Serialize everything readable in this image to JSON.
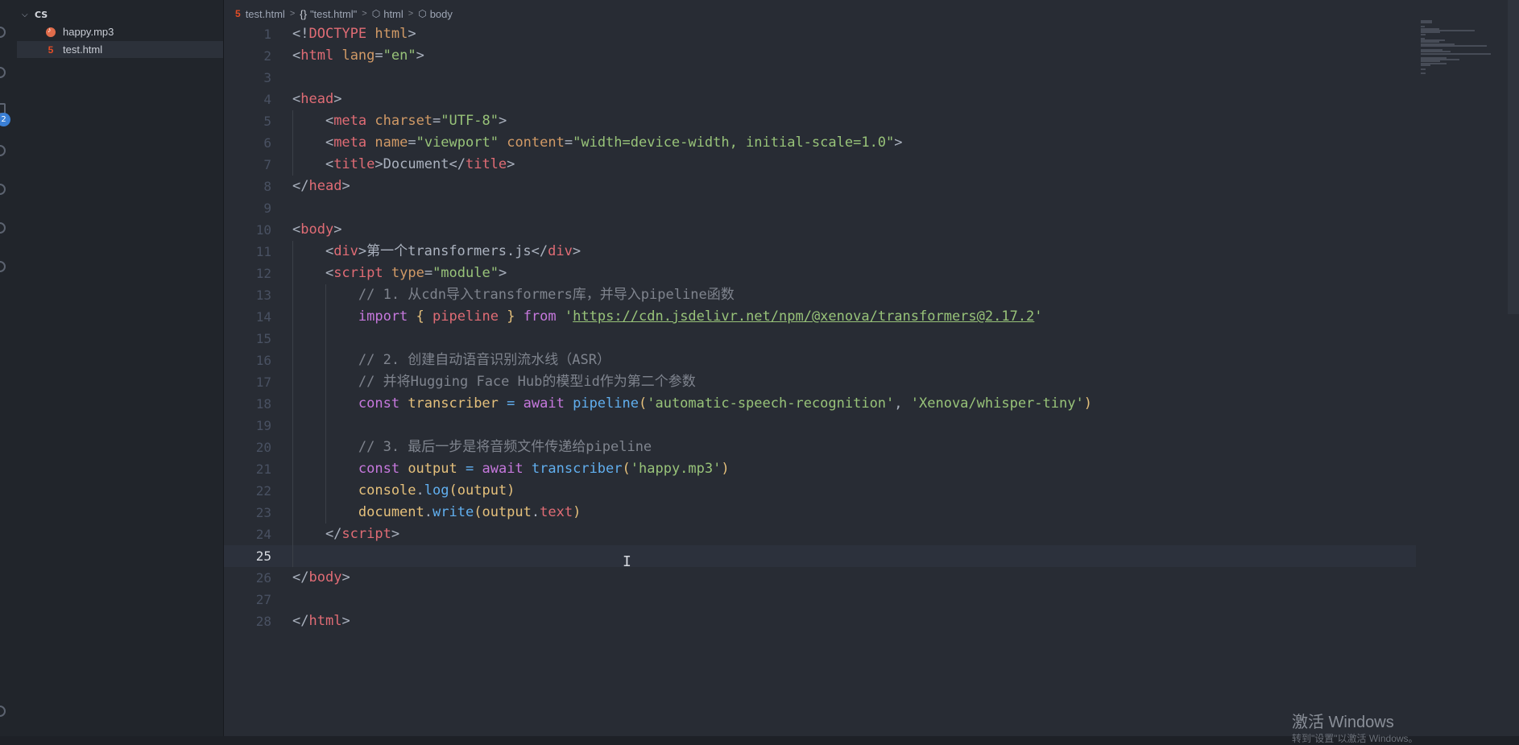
{
  "explorer": {
    "folder": "CS",
    "files": [
      {
        "name": "happy.mp3",
        "icon": "audio-file-icon",
        "active": false
      },
      {
        "name": "test.html",
        "icon": "html-file-icon",
        "active": true
      }
    ]
  },
  "activity_bar": {
    "badge": "2"
  },
  "breadcrumb": {
    "file": "test.html",
    "symbol": "\"test.html\"",
    "element1": "html",
    "element2": "body"
  },
  "editor": {
    "current_line": 25,
    "lines": [
      {
        "n": "1",
        "segs": [
          [
            "p",
            "<!"
          ],
          [
            "tag",
            "DOCTYPE"
          ],
          [
            "p",
            " "
          ],
          [
            "attr",
            "html"
          ],
          [
            "p",
            ">"
          ]
        ]
      },
      {
        "n": "2",
        "segs": [
          [
            "p",
            "<"
          ],
          [
            "tag",
            "html"
          ],
          [
            "p",
            " "
          ],
          [
            "attr",
            "lang"
          ],
          [
            "p",
            "="
          ],
          [
            "str",
            "\"en\""
          ],
          [
            "p",
            ">"
          ]
        ]
      },
      {
        "n": "3",
        "segs": []
      },
      {
        "n": "4",
        "segs": [
          [
            "p",
            "<"
          ],
          [
            "tag",
            "head"
          ],
          [
            "p",
            ">"
          ]
        ]
      },
      {
        "n": "5",
        "segs": [
          [
            "p",
            "    <"
          ],
          [
            "tag",
            "meta"
          ],
          [
            "p",
            " "
          ],
          [
            "attr",
            "charset"
          ],
          [
            "p",
            "="
          ],
          [
            "str",
            "\"UTF-8\""
          ],
          [
            "p",
            ">"
          ]
        ]
      },
      {
        "n": "6",
        "segs": [
          [
            "p",
            "    <"
          ],
          [
            "tag",
            "meta"
          ],
          [
            "p",
            " "
          ],
          [
            "attr",
            "name"
          ],
          [
            "p",
            "="
          ],
          [
            "str",
            "\"viewport\""
          ],
          [
            "p",
            " "
          ],
          [
            "attr",
            "content"
          ],
          [
            "p",
            "="
          ],
          [
            "str",
            "\"width=device-width, initial-scale=1.0\""
          ],
          [
            "p",
            ">"
          ]
        ]
      },
      {
        "n": "7",
        "segs": [
          [
            "p",
            "    <"
          ],
          [
            "tag",
            "title"
          ],
          [
            "p",
            ">Document</"
          ],
          [
            "tag",
            "title"
          ],
          [
            "p",
            ">"
          ]
        ]
      },
      {
        "n": "8",
        "segs": [
          [
            "p",
            "</"
          ],
          [
            "tag",
            "head"
          ],
          [
            "p",
            ">"
          ]
        ]
      },
      {
        "n": "9",
        "segs": []
      },
      {
        "n": "10",
        "segs": [
          [
            "p",
            "<"
          ],
          [
            "tag",
            "body"
          ],
          [
            "p",
            ">"
          ]
        ]
      },
      {
        "n": "11",
        "segs": [
          [
            "p",
            "    <"
          ],
          [
            "tag",
            "div"
          ],
          [
            "p",
            ">第一个transformers.js</"
          ],
          [
            "tag",
            "div"
          ],
          [
            "p",
            ">"
          ]
        ]
      },
      {
        "n": "12",
        "segs": [
          [
            "p",
            "    <"
          ],
          [
            "tag",
            "script"
          ],
          [
            "p",
            " "
          ],
          [
            "attr",
            "type"
          ],
          [
            "p",
            "="
          ],
          [
            "str",
            "\"module\""
          ],
          [
            "p",
            ">"
          ]
        ]
      },
      {
        "n": "13",
        "segs": [
          [
            "com",
            "        // 1. 从cdn导入transformers库，并导入pipeline函数"
          ]
        ]
      },
      {
        "n": "14",
        "segs": [
          [
            "kw",
            "        import"
          ],
          [
            "p",
            " "
          ],
          [
            "var",
            "{"
          ],
          [
            "p",
            " "
          ],
          [
            "tag",
            "pipeline"
          ],
          [
            "p",
            " "
          ],
          [
            "var",
            "}"
          ],
          [
            "p",
            " "
          ],
          [
            "kw",
            "from"
          ],
          [
            "p",
            " "
          ],
          [
            "str",
            "'"
          ],
          [
            "url",
            "https://cdn.jsdelivr.net/npm/@xenova/transformers@2.17.2"
          ],
          [
            "str",
            "'"
          ]
        ]
      },
      {
        "n": "15",
        "segs": []
      },
      {
        "n": "16",
        "segs": [
          [
            "com",
            "        // 2. 创建自动语音识别流水线（ASR）"
          ]
        ]
      },
      {
        "n": "17",
        "segs": [
          [
            "com",
            "        // 并将Hugging Face Hub的模型id作为第二个参数"
          ]
        ]
      },
      {
        "n": "18",
        "segs": [
          [
            "kw",
            "        const"
          ],
          [
            "p",
            " "
          ],
          [
            "var",
            "transcriber"
          ],
          [
            "p",
            " "
          ],
          [
            "fn",
            "="
          ],
          [
            "p",
            " "
          ],
          [
            "kw",
            "await"
          ],
          [
            "p",
            " "
          ],
          [
            "fn",
            "pipeline"
          ],
          [
            "var",
            "("
          ],
          [
            "str",
            "'automatic-speech-recognition'"
          ],
          [
            "p",
            ", "
          ],
          [
            "str",
            "'Xenova/whisper-tiny'"
          ],
          [
            "var",
            ")"
          ]
        ]
      },
      {
        "n": "19",
        "segs": []
      },
      {
        "n": "20",
        "segs": [
          [
            "com",
            "        // 3. 最后一步是将音频文件传递给pipeline"
          ]
        ]
      },
      {
        "n": "21",
        "segs": [
          [
            "kw",
            "        const"
          ],
          [
            "p",
            " "
          ],
          [
            "var",
            "output"
          ],
          [
            "p",
            " "
          ],
          [
            "fn",
            "="
          ],
          [
            "p",
            " "
          ],
          [
            "kw",
            "await"
          ],
          [
            "p",
            " "
          ],
          [
            "fn",
            "transcriber"
          ],
          [
            "var",
            "("
          ],
          [
            "str",
            "'happy.mp3'"
          ],
          [
            "var",
            ")"
          ]
        ]
      },
      {
        "n": "22",
        "segs": [
          [
            "var",
            "        console"
          ],
          [
            "p",
            "."
          ],
          [
            "fn",
            "log"
          ],
          [
            "var",
            "("
          ],
          [
            "var",
            "output"
          ],
          [
            "var",
            ")"
          ]
        ]
      },
      {
        "n": "23",
        "segs": [
          [
            "var",
            "        document"
          ],
          [
            "p",
            "."
          ],
          [
            "fn",
            "write"
          ],
          [
            "var",
            "("
          ],
          [
            "var",
            "output"
          ],
          [
            "p",
            "."
          ],
          [
            "tag",
            "text"
          ],
          [
            "var",
            ")"
          ]
        ]
      },
      {
        "n": "24",
        "segs": [
          [
            "p",
            "    </"
          ],
          [
            "tag",
            "script"
          ],
          [
            "p",
            ">"
          ]
        ]
      },
      {
        "n": "25",
        "segs": []
      },
      {
        "n": "26",
        "segs": [
          [
            "p",
            "</"
          ],
          [
            "tag",
            "body"
          ],
          [
            "p",
            ">"
          ]
        ]
      },
      {
        "n": "27",
        "segs": []
      },
      {
        "n": "28",
        "segs": [
          [
            "p",
            "</"
          ],
          [
            "tag",
            "html"
          ],
          [
            "p",
            ">"
          ]
        ]
      }
    ]
  },
  "watermark": {
    "title": "激活 Windows",
    "subtitle": "转到\"设置\"以激活 Windows。"
  },
  "colors": {
    "tag": "#e06c75",
    "attr": "#d19a66",
    "string": "#98c379",
    "keyword": "#c678dd",
    "function": "#61afef",
    "variable": "#e5c07b",
    "comment": "#7f848e",
    "background": "#282c34"
  }
}
